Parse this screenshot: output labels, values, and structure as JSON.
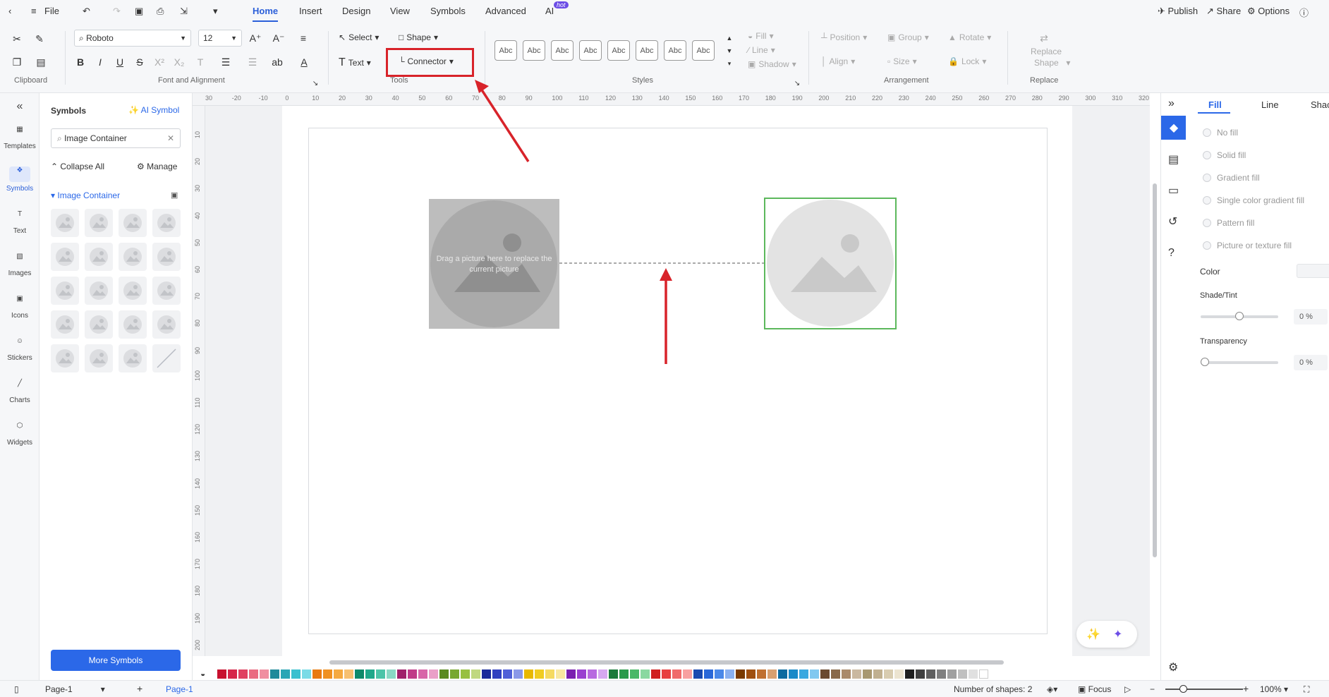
{
  "menubar": {
    "file": "File",
    "tabs": [
      "Home",
      "Insert",
      "Design",
      "View",
      "Symbols",
      "Advanced",
      "AI"
    ],
    "hot": "hot",
    "publish": "Publish",
    "share": "Share",
    "options": "Options"
  },
  "ribbon": {
    "font": "Roboto",
    "size": "12",
    "select": "Select",
    "shape": "Shape",
    "text": "Text",
    "connector": "Connector",
    "abc": "Abc",
    "fill": "Fill",
    "line": "Line",
    "shadow": "Shadow",
    "position": "Position",
    "group": "Group",
    "rotate": "Rotate",
    "align": "Align",
    "size_label": "Size",
    "lock": "Lock",
    "replace1": "Replace",
    "replace2": "Shape",
    "groups": {
      "clipboard": "Clipboard",
      "font": "Font and Alignment",
      "tools": "Tools",
      "styles": "Styles",
      "arrangement": "Arrangement",
      "replace": "Replace"
    }
  },
  "leftrail": [
    "Templates",
    "Symbols",
    "Text",
    "Images",
    "Icons",
    "Stickers",
    "Charts",
    "Widgets"
  ],
  "symbols": {
    "title": "Symbols",
    "ai": "AI Symbol",
    "search": "Image Container",
    "collapse": "Collapse All",
    "manage": "Manage",
    "category": "Image Container",
    "more": "More Symbols"
  },
  "ruler": {
    "top": [
      "30",
      "-20",
      "-10",
      "0",
      "10",
      "20",
      "30",
      "40",
      "50",
      "60",
      "70",
      "80",
      "90",
      "100",
      "110",
      "120",
      "130",
      "140",
      "150",
      "160",
      "170",
      "180",
      "190",
      "200",
      "210",
      "220",
      "230",
      "240",
      "250",
      "260",
      "270",
      "280",
      "290",
      "300",
      "310",
      "320"
    ],
    "left": [
      "10",
      "20",
      "30",
      "40",
      "50",
      "60",
      "70",
      "80",
      "90",
      "100",
      "110",
      "120",
      "130",
      "140",
      "150",
      "160",
      "170",
      "180",
      "190",
      "200"
    ]
  },
  "canvas": {
    "placeholder": "Drag a picture here to replace the current picture"
  },
  "rightpanel": {
    "tabs": [
      "Fill",
      "Line",
      "Shac"
    ],
    "options": [
      "No fill",
      "Solid fill",
      "Gradient fill",
      "Single color gradient fill",
      "Pattern fill",
      "Picture or texture fill"
    ],
    "color": "Color",
    "shade": "Shade/Tint",
    "shade_val": "0 %",
    "transparency": "Transparency",
    "transparency_val": "0 %",
    "shade_level": 0.5,
    "transparency_level": 0
  },
  "status": {
    "page_select": "Page-1",
    "page_tab": "Page-1",
    "shapes": "Number of shapes: 2",
    "focus": "Focus",
    "zoom": "100%"
  },
  "colors": [
    "#c8102e",
    "#d6264a",
    "#e04060",
    "#ea6a80",
    "#f08ea0",
    "#1f8a9a",
    "#2aa6b5",
    "#3bc0cf",
    "#7adbe6",
    "#e87a10",
    "#f09020",
    "#f5a940",
    "#f7c070",
    "#0e8a6a",
    "#1fa88a",
    "#4cc4a8",
    "#8ad8c4",
    "#a0206a",
    "#c03a88",
    "#d866a8",
    "#eaa0c8",
    "#5a8a20",
    "#78a830",
    "#98c040",
    "#c0d880",
    "#1a2a9a",
    "#3040c0",
    "#5060d8",
    "#8a98e8",
    "#e8b800",
    "#f0cc20",
    "#f5da60",
    "#f8e8a0",
    "#7a20b0",
    "#9a40d0",
    "#b86ae0",
    "#d6a8f0",
    "#1a7a3a",
    "#2a9a4a",
    "#4ab868",
    "#8ad8a0",
    "#d02020",
    "#e84040",
    "#f06a6a",
    "#f8a0a0",
    "#1a4ab0",
    "#2a68d8",
    "#4a88e8",
    "#8ab0f0",
    "#7a3a00",
    "#a05010",
    "#c07030",
    "#d8a070",
    "#0a6aa0",
    "#1a8ac8",
    "#3aa8e0",
    "#80c8f0",
    "#6a4a30",
    "#8a6a4a",
    "#aa8a6a",
    "#cab8a0",
    "#a89870",
    "#c0b090",
    "#d8ccb0",
    "#ece4d0",
    "#202020",
    "#404040",
    "#606060",
    "#808080",
    "#a0a0a0",
    "#c0c0c0",
    "#e0e0e0",
    "#ffffff"
  ]
}
